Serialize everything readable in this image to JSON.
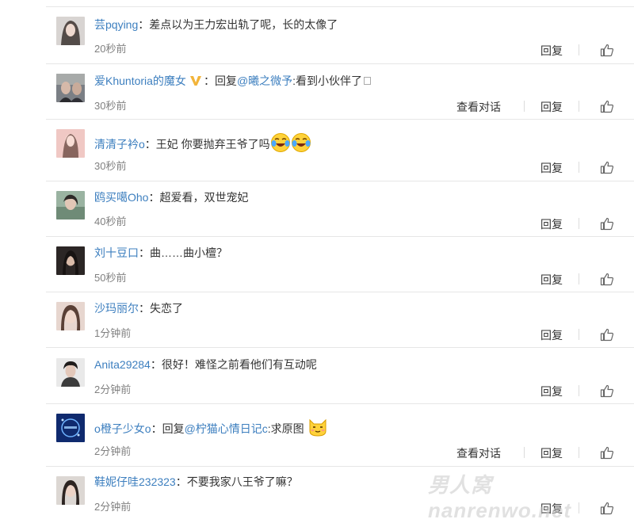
{
  "comments": [
    {
      "user": "芸pqying",
      "sep": "：",
      "text": "差点以为王力宏出轨了呢，长的太像了",
      "time": "20秒前",
      "reply": "回复"
    },
    {
      "user": "爱Khuntoria的魔女",
      "sep": "：",
      "reply_prefix": "回复",
      "mention": "@曦之微予",
      "text": ":看到小伙伴了",
      "time": "30秒前",
      "view_conversation": "查看对话",
      "reply": "回复"
    },
    {
      "user": "清清子衿o",
      "sep": "：",
      "text": "王妃 你要抛弃王爷了吗",
      "time": "30秒前",
      "reply": "回复"
    },
    {
      "user": "鸥买噶Oho",
      "sep": "：",
      "text": "超爱看，双世宠妃",
      "time": "40秒前",
      "reply": "回复"
    },
    {
      "user": "刘十豆口",
      "sep": "：",
      "text": "曲……曲小檀？",
      "time": "50秒前",
      "reply": "回复"
    },
    {
      "user": "沙玛丽尔",
      "sep": "：",
      "text": "失恋了",
      "time": "1分钟前",
      "reply": "回复"
    },
    {
      "user": "Anita29284",
      "sep": "：",
      "text": "很好！难怪之前看他们有互动呢",
      "time": "2分钟前",
      "reply": "回复"
    },
    {
      "user": "o橙子少女o",
      "sep": "：",
      "reply_prefix": "回复",
      "mention": "@柠猫心情日记c",
      "text": ":求原图",
      "time": "2分钟前",
      "view_conversation": "查看对话",
      "reply": "回复"
    },
    {
      "user": "鞋妮仔哇232323",
      "sep": "：",
      "text": "不要我家八王爷了嘛？",
      "time": "2分钟前",
      "reply": "回复"
    }
  ],
  "icons": {
    "like": "thumbs-up-icon",
    "vip": "vip-badge-icon",
    "emoji_cry": "crying-laugh-emoji",
    "emoji_cat": "cat-emoji"
  },
  "colors": {
    "username": "#3d7fbf",
    "time": "#808080",
    "text": "#333333"
  },
  "watermark": "男人窝nanrenwo.net"
}
